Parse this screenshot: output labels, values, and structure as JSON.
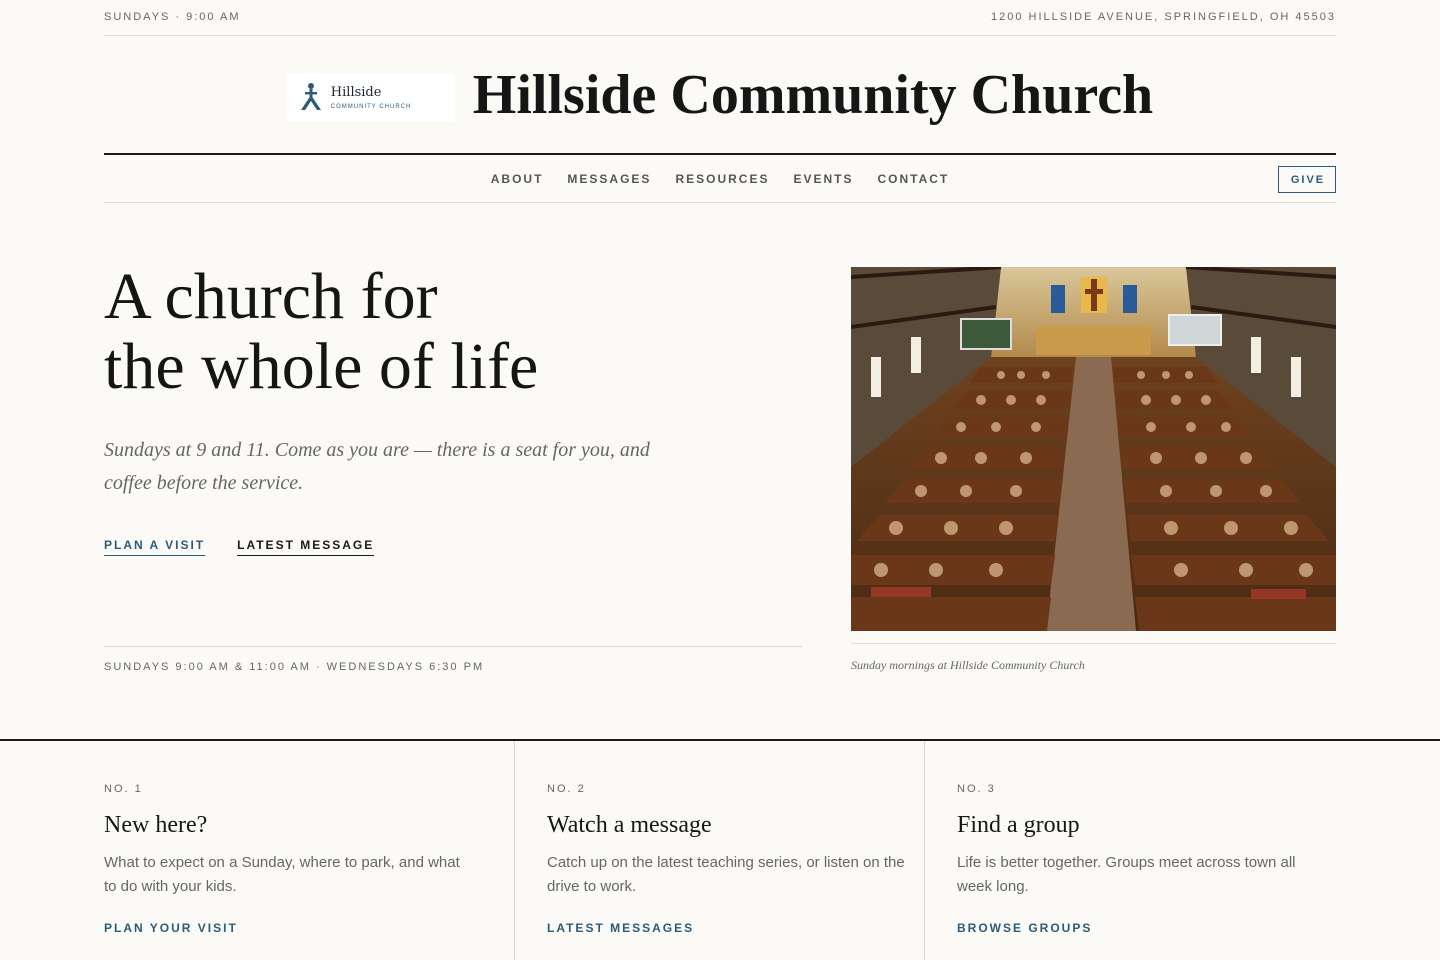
{
  "topbar": {
    "schedule": "SUNDAYS · 9:00 AM",
    "address": "1200 HILLSIDE AVENUE, SPRINGFIELD, OH 45503"
  },
  "masthead": {
    "logo_name": "Hillside",
    "logo_sub": "COMMUNITY CHURCH",
    "title": "Hillside Community Church"
  },
  "nav": {
    "items": [
      {
        "label": "ABOUT"
      },
      {
        "label": "MESSAGES"
      },
      {
        "label": "RESOURCES"
      },
      {
        "label": "EVENTS"
      },
      {
        "label": "CONTACT"
      }
    ],
    "give_label": "GIVE"
  },
  "hero": {
    "title_line1": "A church for",
    "title_line2": "the whole of life",
    "subtitle": "Sundays at 9 and 11. Come as you are — there is a seat for you, and coffee before the service.",
    "cta_primary": "PLAN A VISIT",
    "cta_secondary": "LATEST MESSAGE",
    "hours": "SUNDAYS 9:00 AM & 11:00 AM · WEDNESDAYS 6:30 PM",
    "photo_caption": "Sunday mornings at Hillside Community Church"
  },
  "features": [
    {
      "num": "NO. 1",
      "title": "New here?",
      "body": "What to expect on a Sunday, where to park, and what to do with your kids.",
      "link": "PLAN YOUR VISIT"
    },
    {
      "num": "NO. 2",
      "title": "Watch a message",
      "body": "Catch up on the latest teaching series, or listen on the drive to work.",
      "link": "LATEST MESSAGES"
    },
    {
      "num": "NO. 3",
      "title": "Find a group",
      "body": "Life is better together. Groups meet across town all week long.",
      "link": "BROWSE GROUPS"
    }
  ],
  "colors": {
    "background": "#fbfaf7",
    "accent": "#2c5b7a",
    "rule": "#e3d9d3",
    "text": "#1a1a1a",
    "muted": "#666666"
  }
}
